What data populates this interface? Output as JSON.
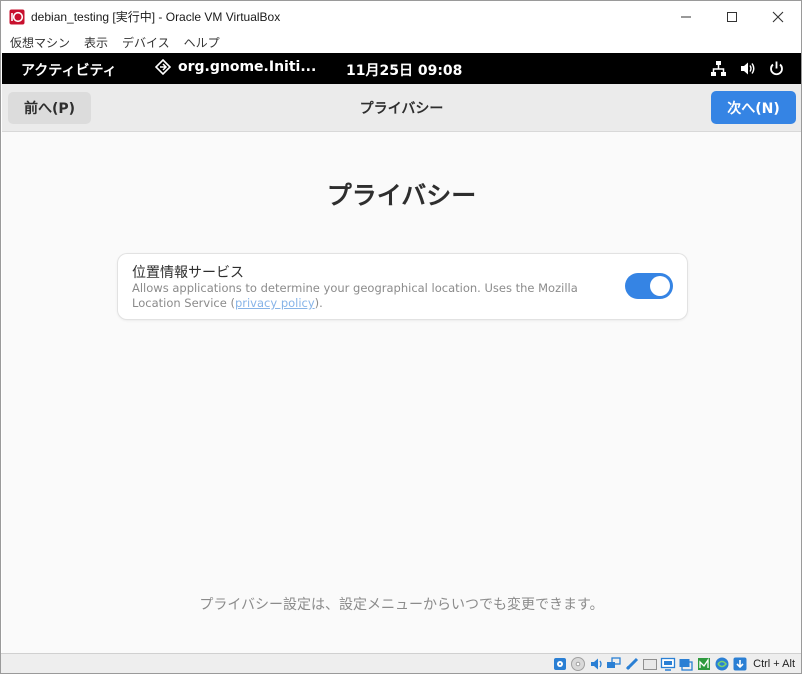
{
  "window": {
    "title": "debian_testing [実行中] - Oracle VM VirtualBox",
    "icons": {
      "app": "virtualbox-icon",
      "minimize": "minimize-icon",
      "maximize": "maximize-icon",
      "close": "close-icon"
    }
  },
  "menubar": {
    "items": [
      {
        "label": "仮想マシン"
      },
      {
        "label": "表示"
      },
      {
        "label": "デバイス"
      },
      {
        "label": "ヘルプ"
      }
    ]
  },
  "gnome_topbar": {
    "activities": "アクティビティ",
    "app_menu": "org.gnome.Initi...",
    "clock": "11月25日  09:08",
    "tray_icons": [
      "network-icon",
      "volume-icon",
      "power-icon"
    ]
  },
  "headerbar": {
    "back_label": "前へ(P)",
    "title": "プライバシー",
    "next_label": "次へ(N)"
  },
  "content": {
    "page_title": "プライバシー",
    "location_service": {
      "title": "位置情報サービス",
      "desc_before": "Allows applications to determine your geographical location. Uses the Mozilla Location Service (",
      "link": "privacy policy",
      "desc_after": ").",
      "enabled": true
    },
    "footer_note": "プライバシー設定は、設定メニューからいつでも変更できます。"
  },
  "statusbar": {
    "icons": [
      "hard-disk-icon",
      "optical-disk-icon",
      "audio-icon",
      "network-adapter-icon",
      "usb-icon",
      "shared-folder-icon",
      "display-icon",
      "video-capture-icon",
      "cpu-icon",
      "mouse-integration-icon",
      "host-key-arrow-icon"
    ],
    "host_key": "Ctrl + Alt"
  },
  "colors": {
    "accent": "#3584e4",
    "topbar": "#000000",
    "headerbar": "#ebebeb",
    "link": "#87b4e8"
  }
}
